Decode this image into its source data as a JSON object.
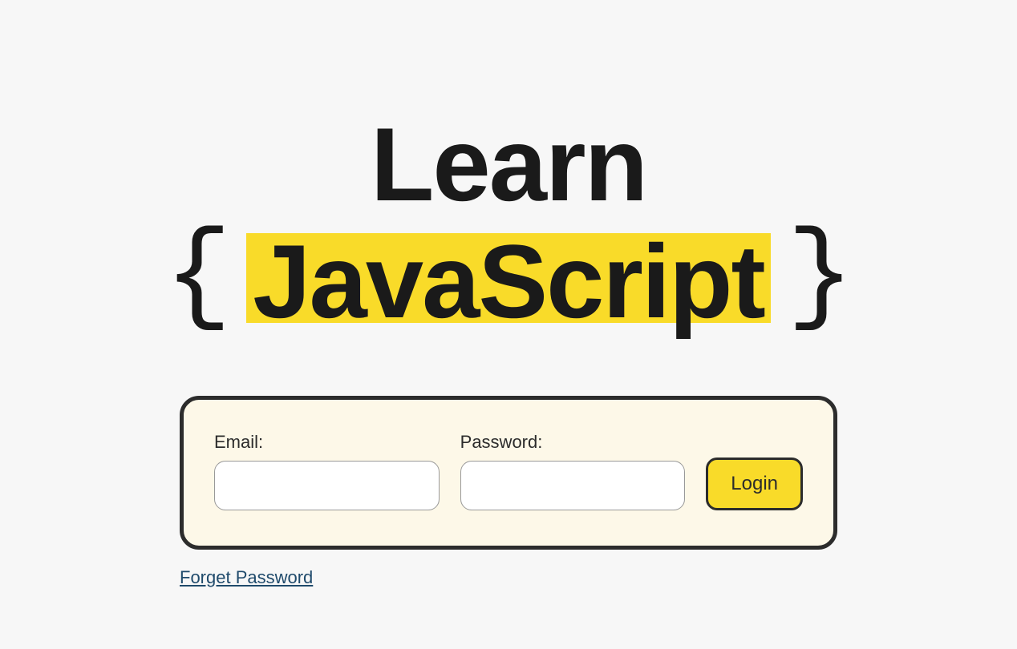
{
  "logo": {
    "line1": "Learn",
    "brace_open": "{",
    "highlighted": "JavaScript",
    "brace_close": "}"
  },
  "form": {
    "email_label": "Email:",
    "email_value": "",
    "password_label": "Password:",
    "password_value": "",
    "login_button": "Login"
  },
  "links": {
    "forgot_password": "Forget Password"
  },
  "colors": {
    "highlight": "#f9db29",
    "box_bg": "#fdf8e8",
    "border": "#2c2c2c",
    "page_bg": "#f7f7f7",
    "link": "#1f4a6b"
  }
}
